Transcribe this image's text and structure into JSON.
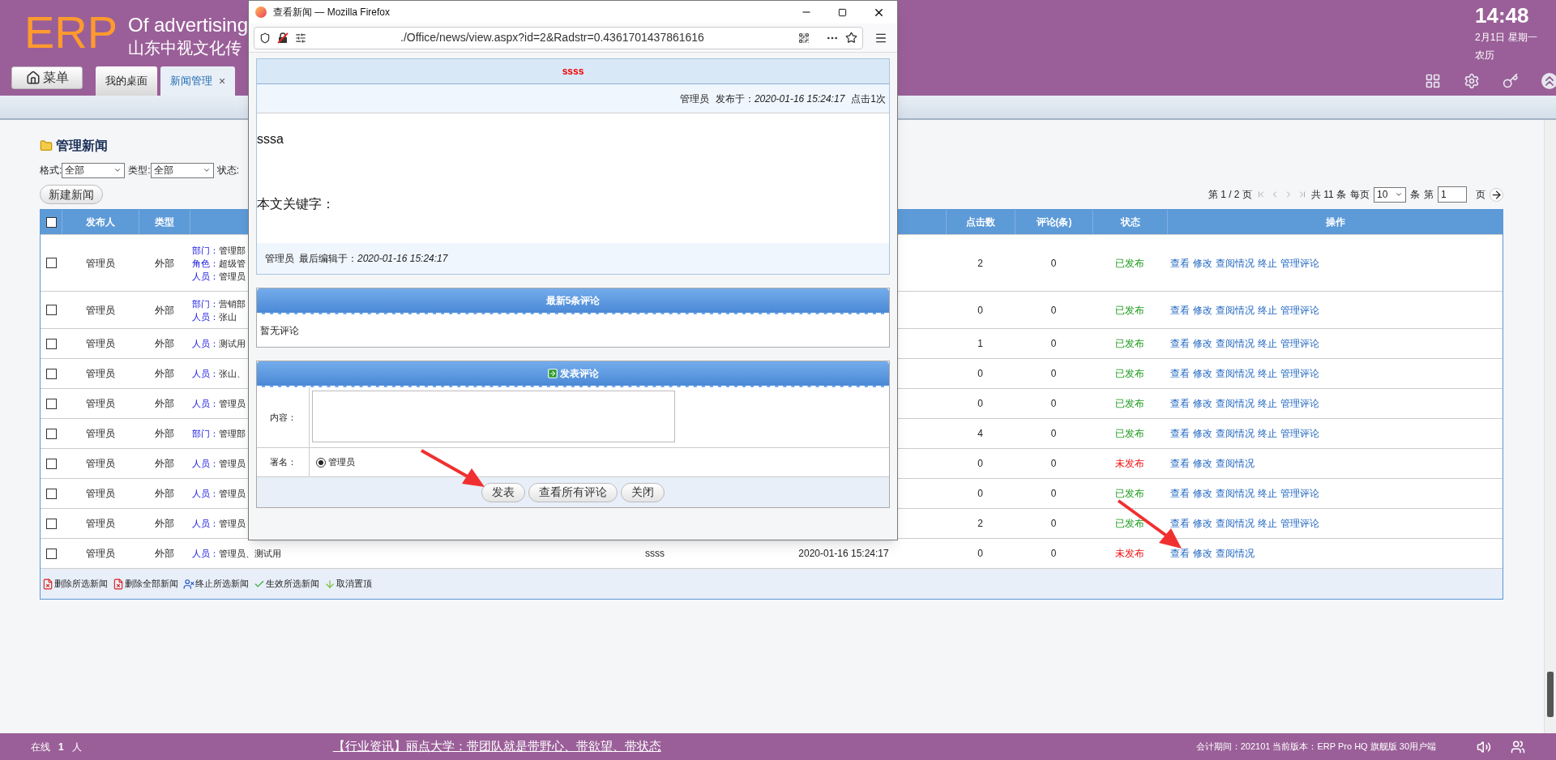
{
  "header": {
    "logo": "ERP",
    "title": "Of advertising",
    "subtitle": "山东中视文化传",
    "menu_button": "菜单"
  },
  "tabs": [
    {
      "label": "我的桌面",
      "selected": false,
      "closable": false
    },
    {
      "label": "新闻管理",
      "selected": true,
      "closable": true
    }
  ],
  "close_mark": "×",
  "clock": {
    "time": "14:48",
    "date": "2月1日 星期一",
    "lunar": "农历"
  },
  "page": {
    "title": "管理新闻",
    "filters": [
      {
        "label": "格式:",
        "value": "全部"
      },
      {
        "label": "类型:",
        "value": "全部"
      },
      {
        "label": "状态:"
      }
    ],
    "new_button": "新建新闻",
    "pagination": {
      "page_info": "第 1 / 2 页",
      "total": "共 11 条",
      "per_page_label": "每页",
      "per_page": "10",
      "unit": "条",
      "goto_label": "第",
      "goto_value": "1",
      "goto_unit": "页"
    }
  },
  "table": {
    "header_checkbox": {
      "checked": false
    },
    "columns": [
      "发布人",
      "类型",
      "点击数",
      "评论(条)",
      "状态",
      "操作"
    ],
    "rows": [
      {
        "checked": false,
        "publisher": "管理员",
        "type": "外部",
        "scope": [
          {
            "label": "部门：",
            "value": "管理部"
          },
          {
            "label": "角色：",
            "value": "超级管"
          },
          {
            "label": "人员：",
            "value": "管理员"
          }
        ],
        "clicks": "2",
        "comments": "0",
        "status": "已发布",
        "published": true,
        "actions": [
          "查看",
          "修改",
          "查阅情况",
          "终止",
          "管理评论"
        ]
      },
      {
        "checked": false,
        "publisher": "管理员",
        "type": "外部",
        "scope": [
          {
            "label": "部门：",
            "value": "营销部"
          },
          {
            "label": "人员：",
            "value": "张山"
          }
        ],
        "clicks": "0",
        "comments": "0",
        "status": "已发布",
        "published": true,
        "actions": [
          "查看",
          "修改",
          "查阅情况",
          "终止",
          "管理评论"
        ]
      },
      {
        "checked": false,
        "publisher": "管理员",
        "type": "外部",
        "scope": [
          {
            "label": "人员：",
            "value": "测试用"
          }
        ],
        "clicks": "1",
        "comments": "0",
        "status": "已发布",
        "published": true,
        "actions": [
          "查看",
          "修改",
          "查阅情况",
          "终止",
          "管理评论"
        ]
      },
      {
        "checked": false,
        "publisher": "管理员",
        "type": "外部",
        "scope": [
          {
            "label": "人员：",
            "value": "张山、"
          }
        ],
        "clicks": "0",
        "comments": "0",
        "status": "已发布",
        "published": true,
        "actions": [
          "查看",
          "修改",
          "查阅情况",
          "终止",
          "管理评论"
        ]
      },
      {
        "checked": false,
        "publisher": "管理员",
        "type": "外部",
        "scope": [
          {
            "label": "人员：",
            "value": "管理员"
          }
        ],
        "clicks": "0",
        "comments": "0",
        "status": "已发布",
        "published": true,
        "actions": [
          "查看",
          "修改",
          "查阅情况",
          "终止",
          "管理评论"
        ]
      },
      {
        "checked": false,
        "publisher": "管理员",
        "type": "外部",
        "scope": [
          {
            "label": "部门：",
            "value": "管理部"
          }
        ],
        "clicks": "4",
        "comments": "0",
        "status": "已发布",
        "published": true,
        "actions": [
          "查看",
          "修改",
          "查阅情况",
          "终止",
          "管理评论"
        ]
      },
      {
        "checked": false,
        "publisher": "管理员",
        "type": "外部",
        "scope": [
          {
            "label": "人员：",
            "value": "管理员"
          }
        ],
        "clicks": "0",
        "comments": "0",
        "status": "未发布",
        "published": false,
        "actions": [
          "查看",
          "修改",
          "查阅情况"
        ]
      },
      {
        "checked": false,
        "publisher": "管理员",
        "type": "外部",
        "scope": [
          {
            "label": "人员：",
            "value": "管理员"
          }
        ],
        "clicks": "0",
        "comments": "0",
        "status": "已发布",
        "published": true,
        "actions": [
          "查看",
          "修改",
          "查阅情况",
          "终止",
          "管理评论"
        ]
      },
      {
        "checked": false,
        "publisher": "管理员",
        "type": "外部",
        "scope": [
          {
            "label": "人员：",
            "value": "管理员"
          }
        ],
        "clicks": "2",
        "comments": "0",
        "status": "已发布",
        "published": true,
        "actions": [
          "查看",
          "修改",
          "查阅情况",
          "终止",
          "管理评论"
        ]
      },
      {
        "checked": false,
        "publisher": "管理员",
        "type": "外部",
        "scope": [
          {
            "label": "人员：",
            "value": "管理员、测试用"
          }
        ],
        "title": "ssss",
        "date": "2020-01-16 15:24:17",
        "clicks": "0",
        "comments": "0",
        "status": "未发布",
        "published": false,
        "actions": [
          "查看",
          "修改",
          "查阅情况"
        ]
      }
    ]
  },
  "toolbar": [
    {
      "label": "删除所选新闻",
      "kind": "delete"
    },
    {
      "label": "删除全部新闻",
      "kind": "delete"
    },
    {
      "label": "终止所选新闻",
      "kind": "stop"
    },
    {
      "label": "生效所选新闻",
      "kind": "approve"
    },
    {
      "label": "取消置顶",
      "kind": "unpin"
    }
  ],
  "popup": {
    "window_title": "查看新闻 — Mozilla Firefox",
    "url": "./Office/news/view.aspx?id=2&Radstr=0.4361701437861616",
    "news_title": "ssss",
    "author": "管理员",
    "published_label": "发布于：",
    "published_at": "2020-01-16 15:24:17",
    "views": "点击1次",
    "body": [
      "sssa",
      "本文关键字："
    ],
    "editor": "管理员",
    "edited_label": "最后编辑于：",
    "edited_at": "2020-01-16 15:24:17",
    "comments_title": "最新5条评论",
    "no_comments": "暂无评论",
    "post_title": "发表评论",
    "content_label": "内容：",
    "sign_label": "署名：",
    "sign_options": [
      {
        "label": "管理员",
        "selected": true
      }
    ],
    "buttons": [
      "发表",
      "查看所有评论",
      "关闭"
    ]
  },
  "status_bar": {
    "online_label": "在线",
    "online_count": "1",
    "online_unit": "人",
    "news": "【行业资讯】丽点大学：带团队就是带野心、带欲望、带状态",
    "info": "会计期间：202101 当前版本：ERP Pro HQ 旗舰版 30用户端"
  }
}
